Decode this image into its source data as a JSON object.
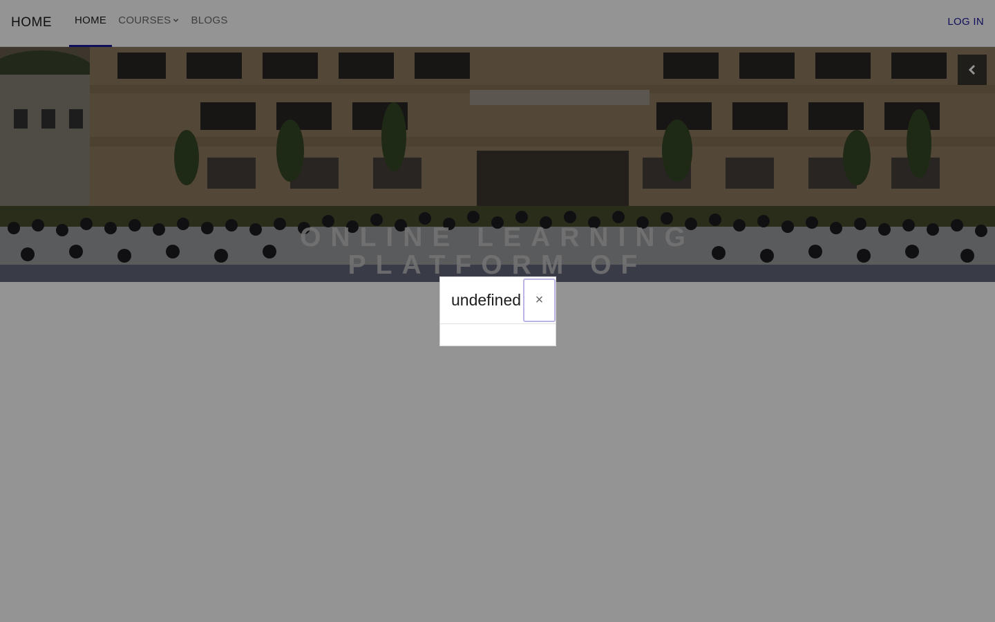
{
  "navbar": {
    "brand": "HOME",
    "items": [
      {
        "label": "HOME",
        "active": true
      },
      {
        "label": "COURSES",
        "has_dropdown": true
      },
      {
        "label": "BLOGS"
      }
    ],
    "login_label": "LOG IN",
    "accent_color": "#1a1a9e"
  },
  "hero": {
    "title_line1": "ONLINE LEARNING",
    "title_line2": "PLATFORM OF",
    "prev_icon": "chevron-left-icon"
  },
  "modal": {
    "title": "undefined",
    "close_symbol": "×"
  }
}
